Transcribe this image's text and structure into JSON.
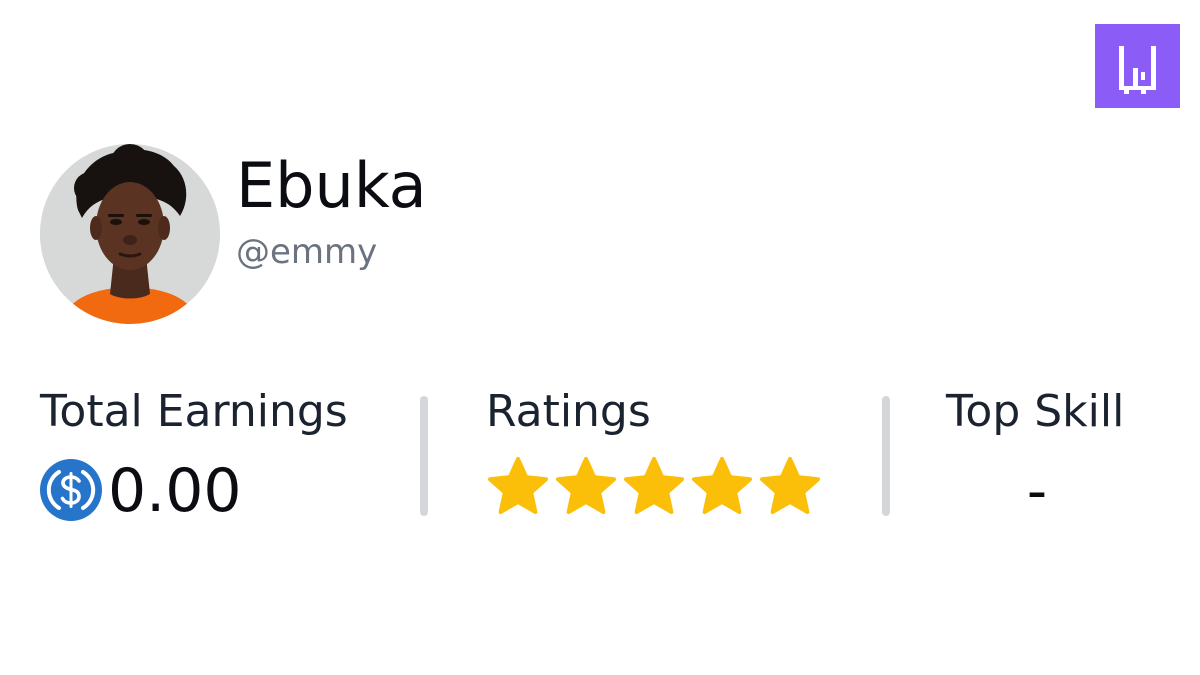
{
  "brand": {
    "logo_icon": "w-logo-icon",
    "logo_color": "#8b5cf6"
  },
  "profile": {
    "name": "Ebuka",
    "handle": "@emmy",
    "avatar_icon": "profile-photo"
  },
  "stats": {
    "earnings": {
      "label": "Total Earnings",
      "currency_icon": "usdc-coin-icon",
      "currency_color": "#2775ca",
      "value": "0.00"
    },
    "ratings": {
      "label": "Ratings",
      "stars_filled": 5,
      "stars_total": 5,
      "star_color": "#fbbf0a"
    },
    "top_skill": {
      "label": "Top Skill",
      "value": "-"
    }
  }
}
